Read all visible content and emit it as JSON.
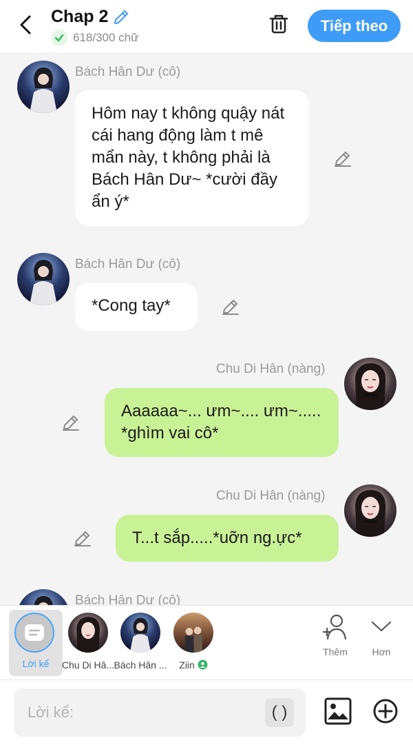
{
  "header": {
    "title": "Chap 2",
    "word_count": "618/300 chữ",
    "next_label": "Tiếp theo"
  },
  "messages": [
    {
      "side": "left",
      "sender": "Bách Hân Dư (cô)",
      "text": "Hôm nay t không quậy nát cái hang động làm t mê mẩn này, t không phải là Bách Hân Dư~ *cười đầy ẩn ý*",
      "avatar": "bach-han-du"
    },
    {
      "side": "left",
      "sender": "Bách Hân Dư (cô)",
      "text": "*Cong tay*",
      "avatar": "bach-han-du"
    },
    {
      "side": "right",
      "sender": "Chu Di Hân (nàng)",
      "text": "Aaaaaa~... ưm~.... ưm~..... *ghìm vai cô*",
      "avatar": "chu-di-han"
    },
    {
      "side": "right",
      "sender": "Chu Di Hân (nàng)",
      "text": "T...t sắp.....*uỡn ng.ực*",
      "avatar": "chu-di-han"
    },
    {
      "side": "left",
      "sender": "Bách Hân Dư (cô)",
      "text": "",
      "avatar": "bach-han-du"
    }
  ],
  "characters": {
    "narration": "Lời kể",
    "items": [
      {
        "name": "Chu Di Hâ...",
        "avatar": "chu-di-han"
      },
      {
        "name": "Bách Hân ...",
        "avatar": "bach-han-du"
      },
      {
        "name": "Ziin",
        "avatar": "ziin"
      }
    ],
    "add_label": "Thêm",
    "more_label": "Hơn"
  },
  "input": {
    "placeholder": "Lời kể:",
    "paren_label": "( )"
  },
  "colors": {
    "accent": "#3e9cf6",
    "bubble_right": "#c9f296",
    "bubble_left": "#ffffff",
    "background": "#f4f4f4"
  },
  "icons": {
    "back": "chevron-left-icon",
    "edit": "pencil-icon",
    "verified": "check-icon",
    "delete": "trash-icon",
    "add_character": "add-person-icon",
    "more": "chevron-down-icon",
    "image": "image-icon",
    "plus": "plus-circle-icon"
  }
}
